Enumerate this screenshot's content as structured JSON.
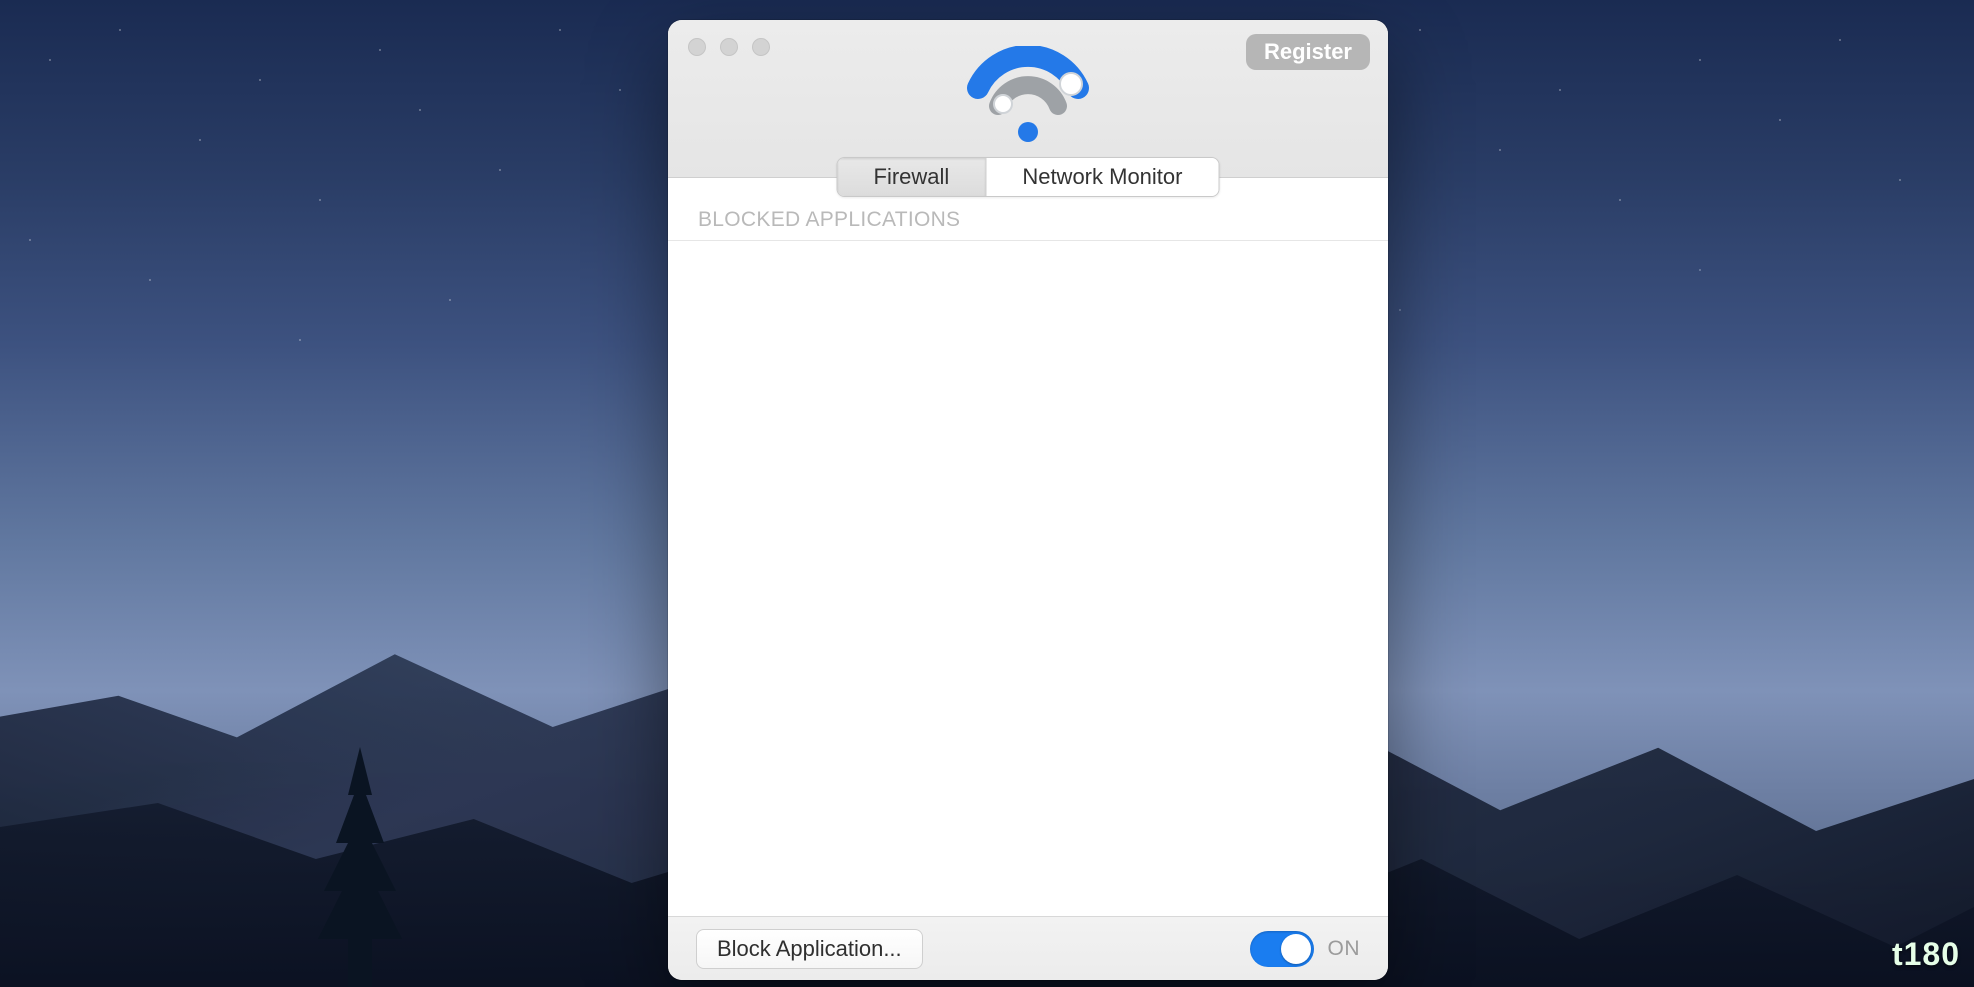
{
  "titlebar": {
    "register_label": "Register"
  },
  "tabs": {
    "firewall_label": "Firewall",
    "network_monitor_label": "Network Monitor",
    "active": "firewall"
  },
  "content": {
    "section_header": "BLOCKED APPLICATIONS",
    "blocked_apps": []
  },
  "footer": {
    "block_app_label": "Block Application...",
    "toggle_state_label": "ON",
    "toggle_on": true
  },
  "watermark": "t180"
}
